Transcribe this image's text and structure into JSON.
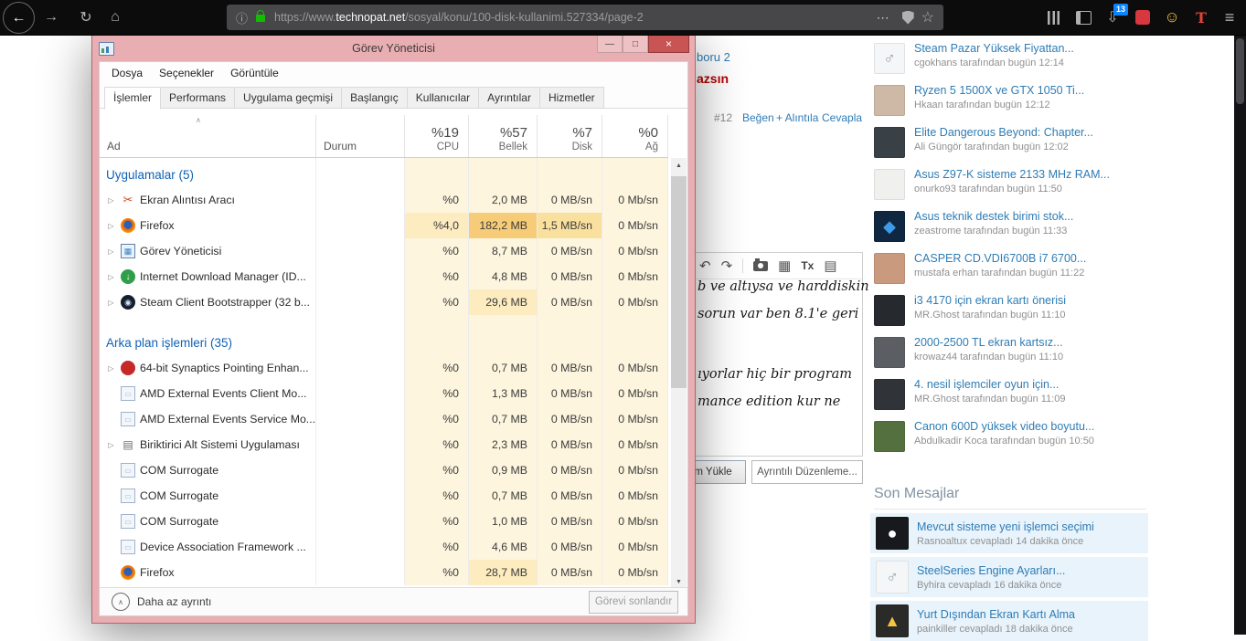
{
  "browser": {
    "url_protocol": "https://www.",
    "url_domain": "technopat.net",
    "url_path": "/sosyal/konu/100-disk-kullanimi.527334/page-2",
    "extension_badge": "13"
  },
  "icons": {
    "back": "←",
    "forward": "→",
    "reload": "↻",
    "home": "⌂",
    "info": "ⓘ",
    "page_actions": "⋯",
    "star": "☆",
    "ext": "⇩",
    "smiley": "☺",
    "t": "T",
    "menu": "≡",
    "undo": "↶",
    "redo": "↷",
    "table": "▦",
    "clear_format": "Tx",
    "draft": "▤",
    "expander": "▷",
    "sort": "∧",
    "up": "▲",
    "down": "▼",
    "min": "—",
    "max": "□",
    "close": "×",
    "collapse": "∧"
  },
  "colors": {
    "forum_link": "#2e7cb5",
    "warning_red": "#b30000",
    "tm_titlebar": "#e9aeb2",
    "tm_close": "#c85454",
    "recent_bg": "#e8f3fb"
  },
  "forum": {
    "fragments": {
      "top_link": "boru 2",
      "red_text": "azsın",
      "post_number": "#12",
      "like": "Beğen",
      "quote": "+ Alıntıla",
      "reply": "Cevapla",
      "quote_line1": "b ve altıysa ve harddiskin",
      "quote_line2": "sorun var ben 8.1'e geri",
      "quote_line3": "ıyorlar hiç bir program",
      "quote_line4": "mance edition kur ne",
      "upload_btn": "m Yükle",
      "advanced_btn": "Ayrıntılı Düzenleme..."
    },
    "threads": [
      {
        "title": "Steam Pazar Yüksek Fiyattan...",
        "meta": "cgokhans tarafından bugün 12:14",
        "avatar": {
          "bg": "#f4f6f7",
          "glyph": "♂",
          "glyph_color": "#90a4ae"
        }
      },
      {
        "title": "Ryzen 5 1500X ve GTX 1050 Ti...",
        "meta": "Hkaan tarafından bugün 12:12",
        "avatar": {
          "bg": "#cdb9a5"
        }
      },
      {
        "title": "Elite Dangerous Beyond: Chapter...",
        "meta": "Ali Güngör tarafından bugün 12:02",
        "avatar": {
          "bg": "#394046"
        }
      },
      {
        "title": "Asus Z97-K sisteme 2133 MHz RAM...",
        "meta": "onurko93 tarafından bugün 11:50",
        "avatar": {
          "bg": "#f0f0ee"
        }
      },
      {
        "title": "Asus teknik destek birimi stok...",
        "meta": "zeastrome tarafından bugün 11:33",
        "avatar": {
          "bg": "#0f2740",
          "glyph": "◆",
          "glyph_color": "#3d9be9"
        }
      },
      {
        "title": "CASPER CD.VDI6700B i7 6700...",
        "meta": "mustafa erhan tarafından bugün 11:22",
        "avatar": {
          "bg": "#c99a7e"
        }
      },
      {
        "title": "i3 4170 için ekran kartı önerisi",
        "meta": "MR.Ghost tarafından bugün 11:10",
        "avatar": {
          "bg": "#26292e"
        }
      },
      {
        "title": "2000-2500 TL ekran kartsız...",
        "meta": "krowaz44 tarafından bugün 11:10",
        "avatar": {
          "bg": "#5b5e63"
        }
      },
      {
        "title": "4. nesil işlemciler oyun için...",
        "meta": "MR.Ghost tarafından bugün 11:09",
        "avatar": {
          "bg": "#303338"
        }
      },
      {
        "title": "Canon 600D yüksek video boyutu...",
        "meta": "Abdulkadir Koca tarafından bugün 10:50",
        "avatar": {
          "bg": "#55703f"
        }
      }
    ],
    "recent_header": "Son Mesajlar",
    "recent": [
      {
        "title": "Mevcut sisteme yeni işlemci seçimi",
        "meta": "Rasnoaltux cevapladı 14 dakika önce",
        "avatar": {
          "bg": "#17191c",
          "glyph": "●",
          "glyph_color": "#ffffff"
        }
      },
      {
        "title": "SteelSeries Engine Ayarları...",
        "meta": "Byhira cevapladı 16 dakika önce",
        "avatar": {
          "bg": "#f4f6f7",
          "glyph": "♂",
          "glyph_color": "#90a4ae"
        }
      },
      {
        "title": "Yurt Dışından Ekran Kartı Alma",
        "meta": "painkiller cevapladı 18 dakika önce",
        "avatar": {
          "bg": "#2a2a28",
          "glyph": "▲",
          "glyph_color": "#f6c344"
        }
      }
    ]
  },
  "task_manager": {
    "title": "Görev Yöneticisi",
    "menu": [
      "Dosya",
      "Seçenekler",
      "Görüntüle"
    ],
    "tabs": [
      {
        "label": "İşlemler",
        "active": true
      },
      {
        "label": "Performans",
        "active": false
      },
      {
        "label": "Uygulama geçmişi",
        "active": false
      },
      {
        "label": "Başlangıç",
        "active": false
      },
      {
        "label": "Kullanıcılar",
        "active": false
      },
      {
        "label": "Ayrıntılar",
        "active": false
      },
      {
        "label": "Hizmetler",
        "active": false
      }
    ],
    "columns": {
      "name": "Ad",
      "status": "Durum",
      "stats": [
        {
          "pct": "%19",
          "label": "CPU"
        },
        {
          "pct": "%57",
          "label": "Bellek"
        },
        {
          "pct": "%7",
          "label": "Disk"
        },
        {
          "pct": "%0",
          "label": "Ağ"
        }
      ]
    },
    "heat_colors": [
      "#fdf5de",
      "#fcecc0",
      "#fae09e",
      "#f7cc78"
    ],
    "icon_defs": {
      "scissors": {
        "glyph": "✂",
        "color": "#d24726",
        "size": 13
      },
      "firefox": {
        "bg": "radial-gradient(circle at 50% 45%, #2b5fb8 0%, #2b5fb8 34%, #e66a10 42%, #ff9500 72%, #ffc40d 100%)",
        "round": true
      },
      "taskmgr": {
        "bg": "#eaf3fc",
        "border": "#5c82a8",
        "glyph": "▦",
        "color": "#3d7fc2",
        "size": 9
      },
      "idm": {
        "bg": "#2e9e49",
        "round": true,
        "glyph": "↓",
        "color": "#ffffff",
        "size": 10
      },
      "steam": {
        "bg": "#16202d",
        "round": true,
        "glyph": "◉",
        "color": "#cfe3f5",
        "size": 9
      },
      "synaptics": {
        "bg": "#c62828",
        "round": true
      },
      "window": {
        "bg": "#f3f7fc",
        "border": "#9db3cc",
        "glyph": "▭",
        "color": "#9db3cc",
        "size": 8
      },
      "printer": {
        "glyph": "▤",
        "color": "#6d6d6d",
        "size": 12
      }
    },
    "rows": [
      {
        "type": "group",
        "label": "Uygulamalar (5)"
      },
      {
        "type": "proc",
        "expand": true,
        "icon": "scissors",
        "name": "Ekran Alıntısı Aracı",
        "cpu": "%0",
        "mem": "2,0 MB",
        "disk": "0 MB/sn",
        "net": "0 Mb/sn",
        "heat": [
          0,
          0,
          0,
          0
        ]
      },
      {
        "type": "proc",
        "expand": true,
        "icon": "firefox",
        "name": "Firefox",
        "cpu": "%4,0",
        "mem": "182,2 MB",
        "disk": "1,5 MB/sn",
        "net": "0 Mb/sn",
        "heat": [
          1,
          3,
          2,
          0
        ]
      },
      {
        "type": "proc",
        "expand": true,
        "icon": "taskmgr",
        "name": "Görev Yöneticisi",
        "cpu": "%0",
        "mem": "8,7 MB",
        "disk": "0 MB/sn",
        "net": "0 Mb/sn",
        "heat": [
          0,
          0,
          0,
          0
        ]
      },
      {
        "type": "proc",
        "expand": true,
        "icon": "idm",
        "name": "Internet Download Manager (ID...",
        "cpu": "%0",
        "mem": "4,8 MB",
        "disk": "0 MB/sn",
        "net": "0 Mb/sn",
        "heat": [
          0,
          0,
          0,
          0
        ]
      },
      {
        "type": "proc",
        "expand": true,
        "icon": "steam",
        "name": "Steam Client Bootstrapper (32 b...",
        "cpu": "%0",
        "mem": "29,6 MB",
        "disk": "0 MB/sn",
        "net": "0 Mb/sn",
        "heat": [
          0,
          1,
          0,
          0
        ]
      },
      {
        "type": "group",
        "label": "Arka plan işlemleri (35)",
        "tall": true
      },
      {
        "type": "proc",
        "expand": true,
        "icon": "synaptics",
        "name": "64-bit Synaptics Pointing Enhan...",
        "cpu": "%0",
        "mem": "0,7 MB",
        "disk": "0 MB/sn",
        "net": "0 Mb/sn",
        "heat": [
          0,
          0,
          0,
          0
        ]
      },
      {
        "type": "proc",
        "expand": false,
        "icon": "window",
        "name": "AMD External Events Client Mo...",
        "cpu": "%0",
        "mem": "1,3 MB",
        "disk": "0 MB/sn",
        "net": "0 Mb/sn",
        "heat": [
          0,
          0,
          0,
          0
        ]
      },
      {
        "type": "proc",
        "expand": false,
        "icon": "window",
        "name": "AMD External Events Service Mo...",
        "cpu": "%0",
        "mem": "0,7 MB",
        "disk": "0 MB/sn",
        "net": "0 Mb/sn",
        "heat": [
          0,
          0,
          0,
          0
        ]
      },
      {
        "type": "proc",
        "expand": true,
        "icon": "printer",
        "name": "Biriktirici Alt Sistemi Uygulaması",
        "cpu": "%0",
        "mem": "2,3 MB",
        "disk": "0 MB/sn",
        "net": "0 Mb/sn",
        "heat": [
          0,
          0,
          0,
          0
        ]
      },
      {
        "type": "proc",
        "expand": false,
        "icon": "window",
        "name": "COM Surrogate",
        "cpu": "%0",
        "mem": "0,9 MB",
        "disk": "0 MB/sn",
        "net": "0 Mb/sn",
        "heat": [
          0,
          0,
          0,
          0
        ]
      },
      {
        "type": "proc",
        "expand": false,
        "icon": "window",
        "name": "COM Surrogate",
        "cpu": "%0",
        "mem": "0,7 MB",
        "disk": "0 MB/sn",
        "net": "0 Mb/sn",
        "heat": [
          0,
          0,
          0,
          0
        ]
      },
      {
        "type": "proc",
        "expand": false,
        "icon": "window",
        "name": "COM Surrogate",
        "cpu": "%0",
        "mem": "1,0 MB",
        "disk": "0 MB/sn",
        "net": "0 Mb/sn",
        "heat": [
          0,
          0,
          0,
          0
        ]
      },
      {
        "type": "proc",
        "expand": false,
        "icon": "window",
        "name": "Device Association Framework ...",
        "cpu": "%0",
        "mem": "4,6 MB",
        "disk": "0 MB/sn",
        "net": "0 Mb/sn",
        "heat": [
          0,
          0,
          0,
          0
        ]
      },
      {
        "type": "proc",
        "expand": false,
        "icon": "firefox",
        "name": "Firefox",
        "cpu": "%0",
        "mem": "28,7 MB",
        "disk": "0 MB/sn",
        "net": "0 Mb/sn",
        "heat": [
          0,
          1,
          0,
          0
        ]
      }
    ],
    "footer": {
      "details_toggle": "Daha az ayrıntı",
      "end_task": "Görevi sonlandır"
    }
  }
}
